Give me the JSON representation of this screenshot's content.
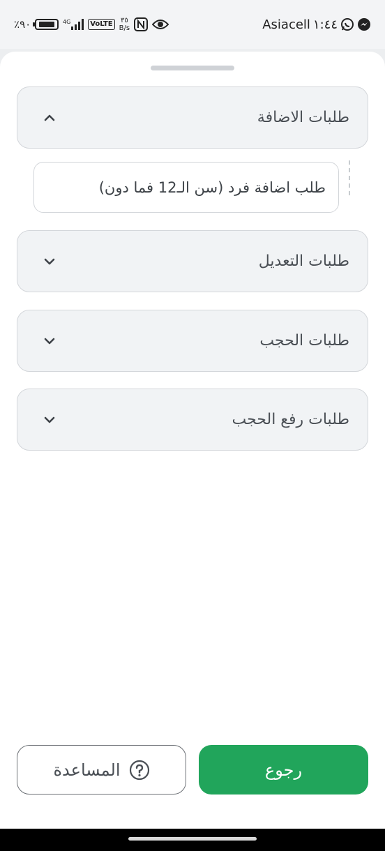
{
  "status_bar": {
    "carrier": "Asiacell",
    "time": "١:٤٤",
    "battery_percent": "٪٩٠",
    "network": "4G",
    "volte": "VoLTE",
    "speed_value": "٣٥",
    "speed_unit": "B/s"
  },
  "sheet": {
    "sections": [
      {
        "label": "طلبات الاضافة",
        "expanded": true
      },
      {
        "label": "طلبات التعديل",
        "expanded": false
      },
      {
        "label": "طلبات الحجب",
        "expanded": false
      },
      {
        "label": "طلبات رفع الحجب",
        "expanded": false
      }
    ],
    "sub_items": [
      {
        "label": "طلب اضافة فرد (سن الـ12 فما دون)"
      }
    ]
  },
  "buttons": {
    "back_label": "رجوع",
    "help_label": "المساعدة"
  },
  "colors": {
    "primary": "#21a55b",
    "card_bg": "#f1f3f5",
    "border": "#d3d6da"
  }
}
